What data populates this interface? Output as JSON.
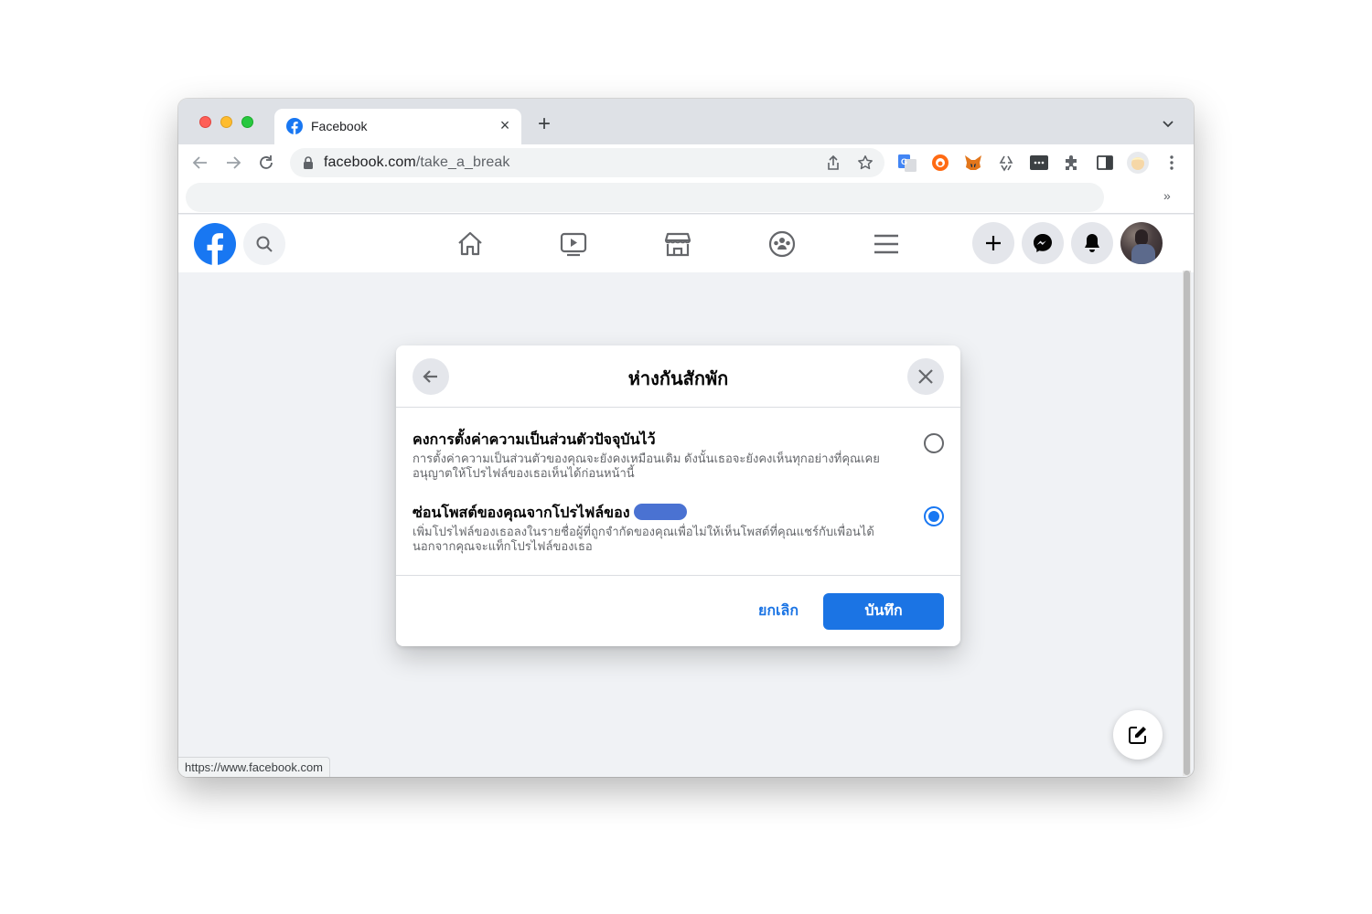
{
  "browser": {
    "tab": {
      "title": "Facebook",
      "close_label": "×",
      "new_tab_label": "+"
    },
    "address": {
      "host": "facebook.com",
      "path": "/take_a_break"
    },
    "bookmarks_overflow_label": "»",
    "status_url": "https://www.facebook.com"
  },
  "facebook": {
    "brand_color": "#1877f2",
    "nav_icons": [
      "home-icon",
      "watch-icon",
      "marketplace-icon",
      "groups-icon",
      "menu-icon"
    ],
    "header_actions": [
      "create-icon",
      "messenger-icon",
      "notifications-icon",
      "account-avatar"
    ]
  },
  "dialog": {
    "title": "ห่างกันสักพัก",
    "options": [
      {
        "title": "คงการตั้งค่าความเป็นส่วนตัวปัจจุบันไว้",
        "desc_line1": "การตั้งค่าความเป็นส่วนตัวของคุณจะยังคงเหมือนเดิม ดังนั้นเธอจะยังคงเห็นทุกอย่างที่คุณเคย",
        "desc_line2": "อนุญาตให้โปรไฟล์ของเธอเห็นได้ก่อนหน้านี้",
        "selected": false
      },
      {
        "title": "ซ่อนโพสต์ของคุณจากโปรไฟล์ของ",
        "desc_line1": "เพิ่มโปรไฟล์ของเธอลงในรายชื่อผู้ที่ถูกจำกัดของคุณเพื่อไม่ให้เห็นโพสต์ที่คุณแชร์กับเพื่อนได้",
        "desc_line2": "นอกจากคุณจะแท็กโปรไฟล์ของเธอ",
        "selected": true
      }
    ],
    "cancel_label": "ยกเลิก",
    "save_label": "บันทึก"
  }
}
